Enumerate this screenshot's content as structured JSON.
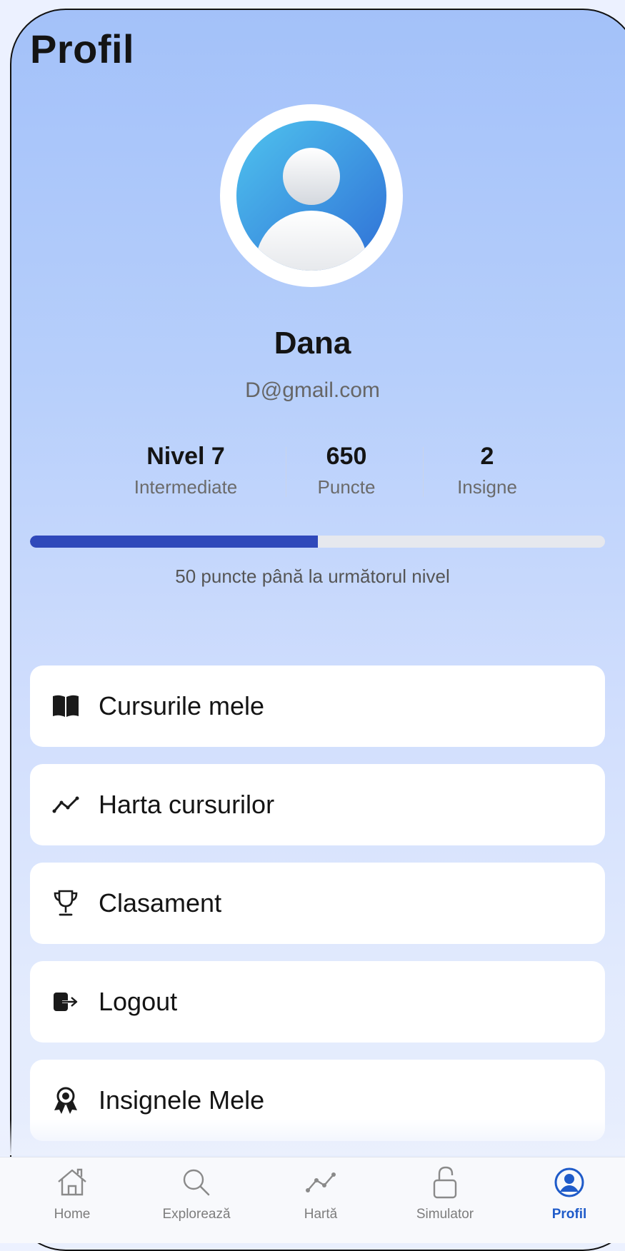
{
  "header": {
    "title": "Profil"
  },
  "profile": {
    "name": "Dana",
    "email": "D@gmail.com"
  },
  "stats": [
    {
      "value": "Nivel 7",
      "label": "Intermediate"
    },
    {
      "value": "650",
      "label": "Puncte"
    },
    {
      "value": "2",
      "label": "Insigne"
    }
  ],
  "progress": {
    "fraction": 0.5,
    "label": "50 puncte până la următorul nivel",
    "fill_color": "#2f48ba"
  },
  "menu": [
    {
      "label": "Cursurile mele",
      "icon": "book-icon"
    },
    {
      "label": "Harta cursurilor",
      "icon": "trend-line-icon"
    },
    {
      "label": "Clasament",
      "icon": "trophy-icon"
    },
    {
      "label": "Logout",
      "icon": "logout-icon"
    },
    {
      "label": "Insignele Mele",
      "icon": "award-icon"
    }
  ],
  "tabbar": {
    "active": "Profil",
    "active_color": "#1f5bc9",
    "tabs": [
      {
        "label": "Home",
        "icon": "home-icon"
      },
      {
        "label": "Explorează",
        "icon": "search-icon"
      },
      {
        "label": "Hartă",
        "icon": "trend-line-icon"
      },
      {
        "label": "Simulator",
        "icon": "unlock-icon"
      },
      {
        "label": "Profil",
        "icon": "user-circle-icon"
      }
    ]
  }
}
